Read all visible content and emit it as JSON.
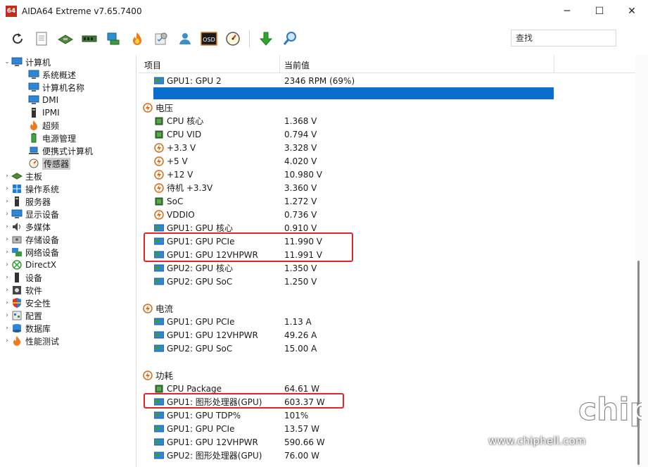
{
  "window": {
    "app_icon_text": "64",
    "title": "AIDA64 Extreme v7.65.7400",
    "minimize": "─",
    "maximize": "☐",
    "close": "✕"
  },
  "toolbar": {
    "search_placeholder": "查找",
    "buttons": [
      "refresh-icon",
      "report-icon",
      "motherboard-icon",
      "memory-icon",
      "network-icon",
      "flame-icon",
      "benchmark-icon",
      "user-icon",
      "osd-icon",
      "gauge-icon",
      "download-icon",
      "search-tool-icon"
    ],
    "osd_label": "OSD"
  },
  "sidebar": {
    "root": "计算机",
    "children": [
      "系统概述",
      "计算机名称",
      "DMI",
      "IPMI",
      "超频",
      "电源管理",
      "便携式计算机",
      "传感器"
    ],
    "sections": [
      "主板",
      "操作系统",
      "服务器",
      "显示设备",
      "多媒体",
      "存储设备",
      "网络设备",
      "DirectX",
      "设备",
      "软件",
      "安全性",
      "配置",
      "数据库",
      "性能测试"
    ]
  },
  "table": {
    "col_item": "项目",
    "col_value": "当前值",
    "top_row": {
      "label": "GPU1: GPU 2",
      "value": "2346 RPM  (69%)"
    },
    "voltage": {
      "title": "电压",
      "rows": [
        {
          "icon": "chip",
          "label": "CPU 核心",
          "value": "1.368 V"
        },
        {
          "icon": "chip",
          "label": "CPU VID",
          "value": "0.794 V"
        },
        {
          "icon": "volt",
          "label": "+3.3 V",
          "value": "3.328 V"
        },
        {
          "icon": "volt",
          "label": "+5 V",
          "value": "4.020 V"
        },
        {
          "icon": "volt",
          "label": "+12 V",
          "value": "10.980 V"
        },
        {
          "icon": "volt",
          "label": "待机 +3.3V",
          "value": "3.360 V"
        },
        {
          "icon": "chip",
          "label": "SoC",
          "value": "1.272 V"
        },
        {
          "icon": "volt",
          "label": "VDDIO",
          "value": "0.736 V"
        },
        {
          "icon": "gpu",
          "label": "GPU1: GPU 核心",
          "value": "0.910 V"
        },
        {
          "icon": "gpu",
          "label": "GPU1: GPU PCIe",
          "value": "11.990 V"
        },
        {
          "icon": "gpu",
          "label": "GPU1: GPU 12VHPWR",
          "value": "11.991 V"
        },
        {
          "icon": "gpu",
          "label": "GPU2: GPU 核心",
          "value": "1.350 V"
        },
        {
          "icon": "gpu",
          "label": "GPU2: GPU SoC",
          "value": "1.250 V"
        }
      ]
    },
    "current": {
      "title": "电流",
      "rows": [
        {
          "icon": "gpu",
          "label": "GPU1: GPU PCIe",
          "value": "1.13 A"
        },
        {
          "icon": "gpu",
          "label": "GPU1: GPU 12VHPWR",
          "value": "49.26 A"
        },
        {
          "icon": "gpu",
          "label": "GPU2: GPU SoC",
          "value": "15.00 A"
        }
      ]
    },
    "power": {
      "title": "功耗",
      "rows": [
        {
          "icon": "chip",
          "label": "CPU Package",
          "value": "64.61 W"
        },
        {
          "icon": "gpu",
          "label": "GPU1: 图形处理器(GPU)",
          "value": "603.37 W"
        },
        {
          "icon": "gpu",
          "label": "GPU1: GPU TDP%",
          "value": "101%"
        },
        {
          "icon": "gpu",
          "label": "GPU1: GPU PCIe",
          "value": "13.57 W"
        },
        {
          "icon": "gpu",
          "label": "GPU1: GPU 12VHPWR",
          "value": "590.66 W"
        },
        {
          "icon": "gpu",
          "label": "GPU2: 图形处理器(GPU)",
          "value": "76.00 W"
        }
      ]
    }
  },
  "watermark": {
    "url": "www.chiphell.com",
    "logo_text": "chip hell"
  },
  "colors": {
    "selection": "#0a6ecf",
    "highlight_box": "#e2252b",
    "title_icon": "#c42b1c"
  }
}
